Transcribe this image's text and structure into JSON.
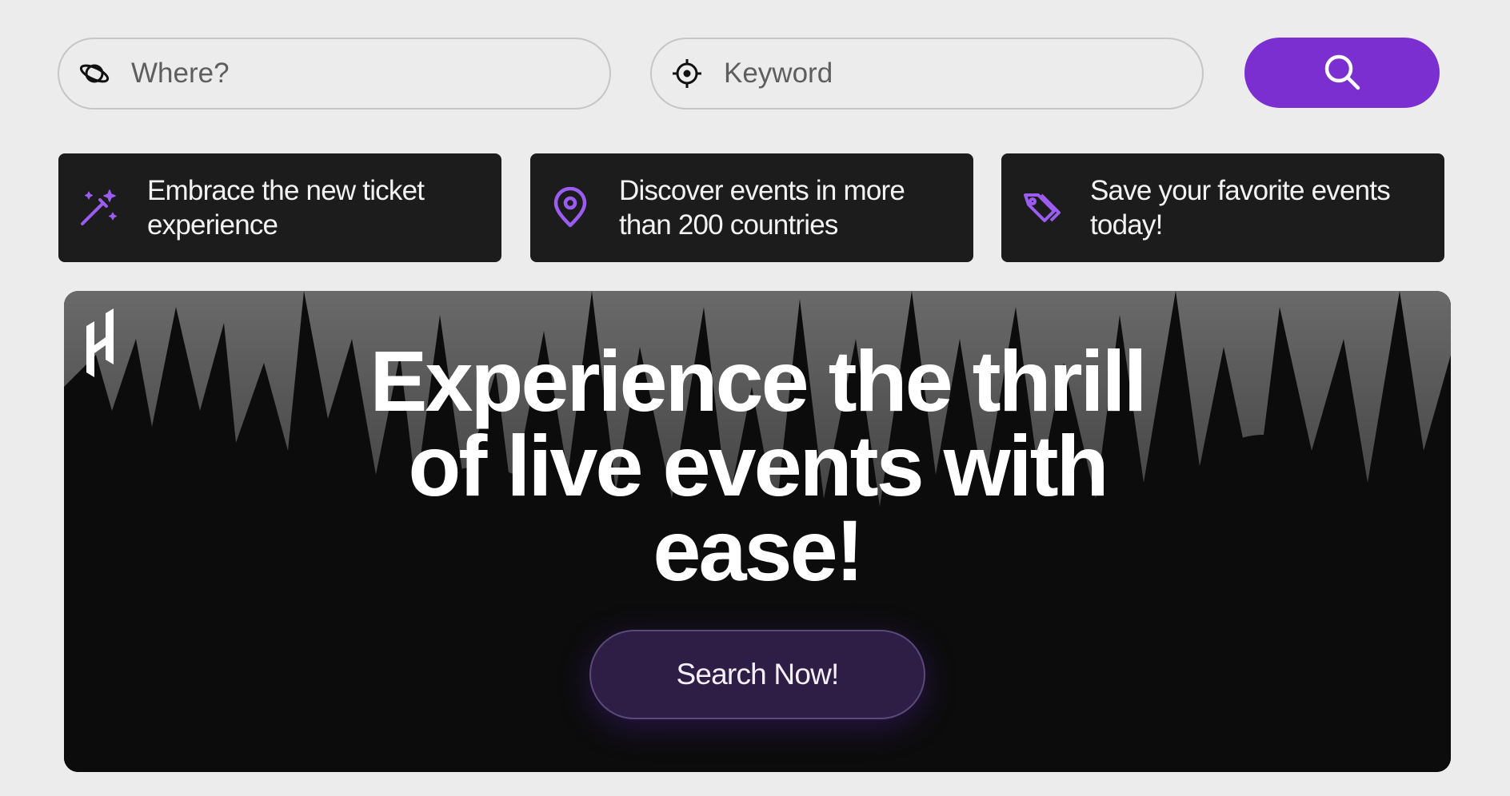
{
  "search": {
    "where_placeholder": "Where?",
    "keyword_placeholder": "Keyword",
    "where_icon": "planet-icon",
    "keyword_icon": "crosshair-icon",
    "button_icon": "search-icon"
  },
  "features": [
    {
      "icon": "magic-wand-icon",
      "text": "Embrace the new ticket experience"
    },
    {
      "icon": "map-pin-icon",
      "text": "Discover events in more than 200 countries"
    },
    {
      "icon": "tags-icon",
      "text": "Save your favorite events today!"
    }
  ],
  "hero": {
    "headline": "Experience the thrill of live events with ease!",
    "cta_label": "Search Now!"
  },
  "colors": {
    "accent": "#7b2fd0",
    "feature_bg": "#1c1c1c",
    "icon_purple": "#9b5cf0",
    "page_bg": "#ececec"
  }
}
